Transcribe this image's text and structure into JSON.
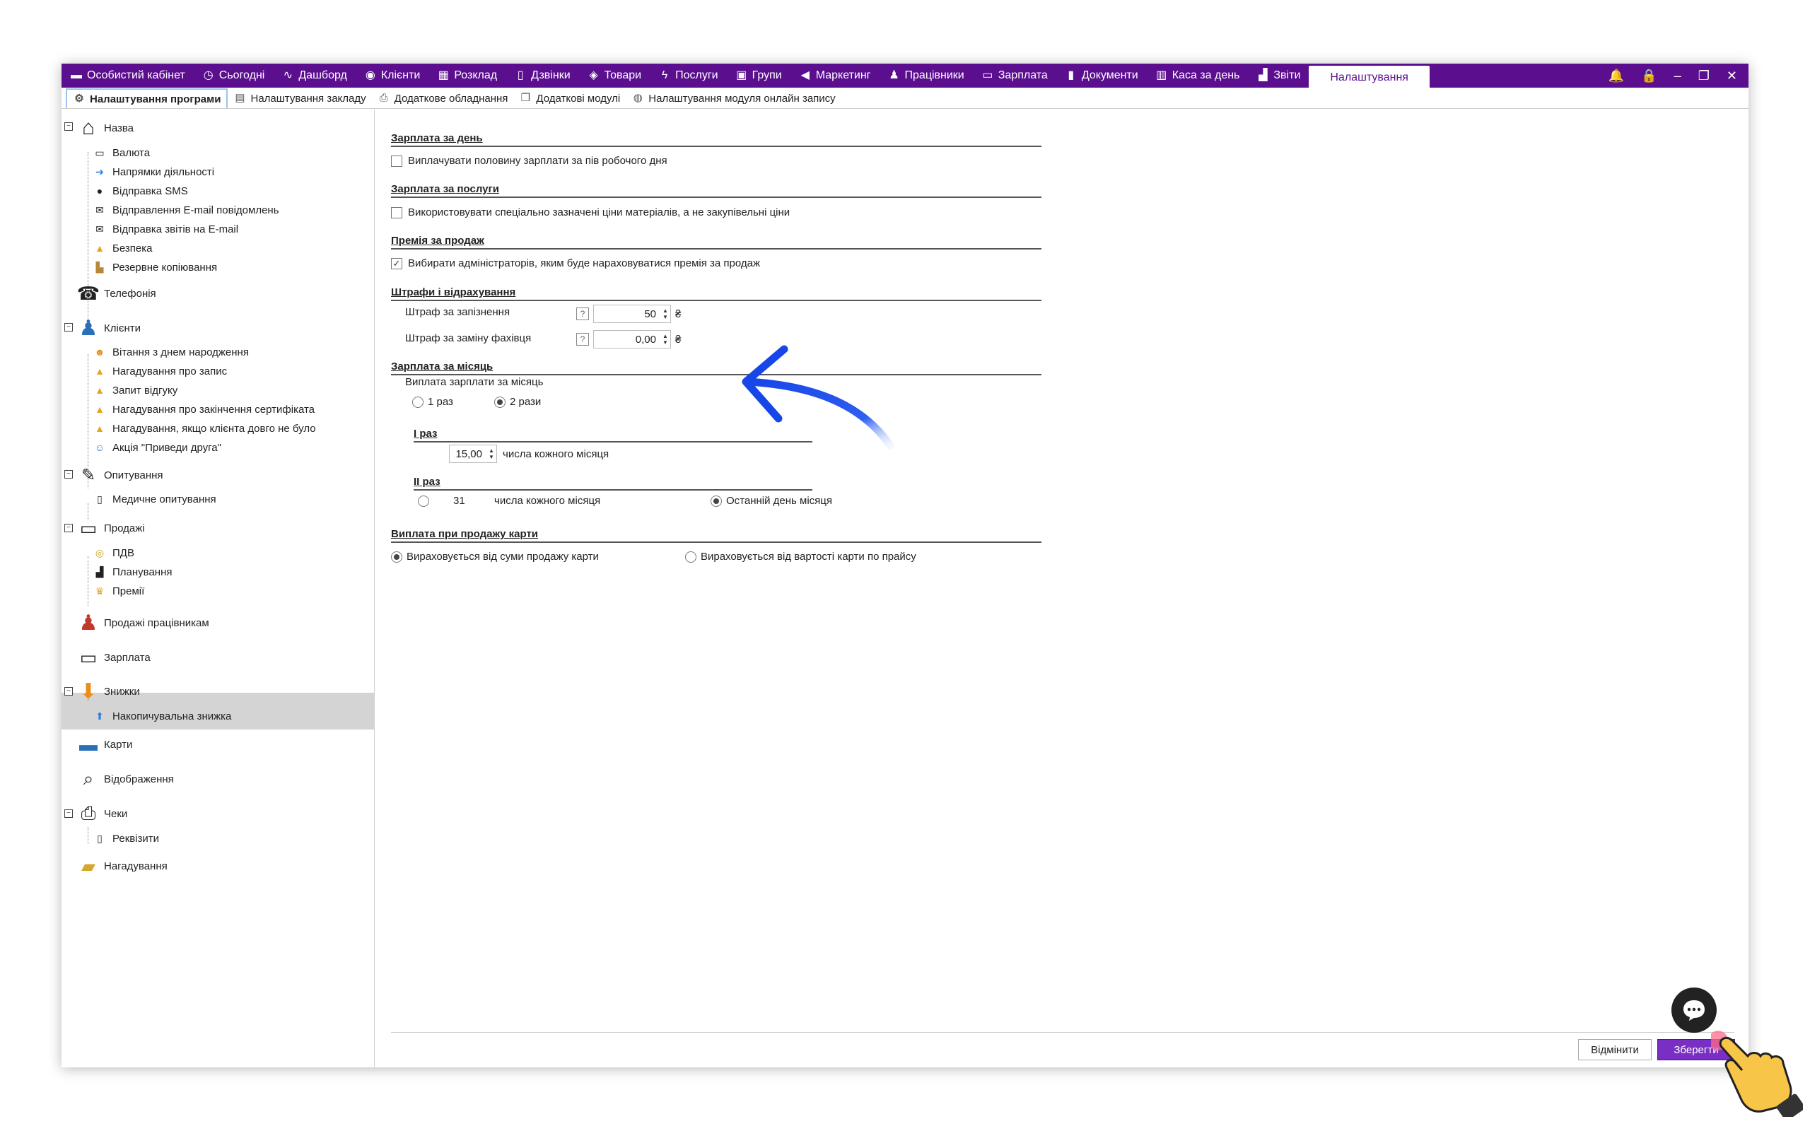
{
  "topnav": {
    "items": [
      {
        "label": "Особистий кабінет",
        "icon": "briefcase-icon"
      },
      {
        "label": "Сьогодні",
        "icon": "clock-icon"
      },
      {
        "label": "Дашборд",
        "icon": "pulse-icon"
      },
      {
        "label": "Клієнти",
        "icon": "user-circle-icon"
      },
      {
        "label": "Розклад",
        "icon": "calendar-icon"
      },
      {
        "label": "Дзвінки",
        "icon": "phone-icon"
      },
      {
        "label": "Товари",
        "icon": "box-icon"
      },
      {
        "label": "Послуги",
        "icon": "lightning-icon"
      },
      {
        "label": "Групи",
        "icon": "group-icon"
      },
      {
        "label": "Маркетинг",
        "icon": "megaphone-icon"
      },
      {
        "label": "Працівники",
        "icon": "person-icon"
      },
      {
        "label": "Зарплата",
        "icon": "money-icon"
      },
      {
        "label": "Документи",
        "icon": "document-icon"
      },
      {
        "label": "Каса за день",
        "icon": "calculator-icon"
      },
      {
        "label": "Звіти",
        "icon": "bar-chart-icon"
      }
    ],
    "active": "Налаштування"
  },
  "subtabs": [
    {
      "label": "Налаштування програми",
      "icon": "gear-icon"
    },
    {
      "label": "Налаштування закладу",
      "icon": "building-icon"
    },
    {
      "label": "Додаткове обладнання",
      "icon": "printer-icon"
    },
    {
      "label": "Додаткові модулі",
      "icon": "module-icon"
    },
    {
      "label": "Налаштування модуля онлайн запису",
      "icon": "globe-icon"
    }
  ],
  "tree": {
    "nazva": "Назва",
    "valiuta": "Валюта",
    "napriamky": "Напрямки діяльності",
    "sms": "Відправка SMS",
    "email": "Відправлення E-mail повідомлень",
    "zvity_email": "Відправка звітів на E-mail",
    "bezpeka": "Безпека",
    "backup": "Резервне копіювання",
    "telefonia": "Телефонія",
    "klienty": "Клієнти",
    "birthday": "Вітання з днем народження",
    "reminder": "Нагадування про запис",
    "feedback": "Запит відгуку",
    "certificate": "Нагадування про закінчення сертифіката",
    "absent": "Нагадування, якщо клієнта довго не було",
    "friend": "Акція \"Приведи друга\"",
    "opytuvannia": "Опитування",
    "medical": "Медичне опитування",
    "prodazhi": "Продажі",
    "pdv": "ПДВ",
    "planning": "Планування",
    "premii": "Премії",
    "prodazhi_prac": "Продажі працівникам",
    "zarplata": "Зарплата",
    "znyzhky": "Знижки",
    "nakopychuvalna": "Накопичувальна знижка",
    "karty": "Карти",
    "vidobrazhennia": "Відображення",
    "cheky": "Чеки",
    "rekvizyty": "Реквізити",
    "nahaduvannia": "Нагадування"
  },
  "content": {
    "sec_day": "Зарплата за день",
    "half_day": "Виплачувати половину зарплати за пів робочого дня",
    "sec_services": "Зарплата за послуги",
    "special_prices": "Використовувати спеціально зазначені ціни матеріалів, а не закупівельні ціни",
    "sec_bonus": "Премія за продаж",
    "choose_admins": "Вибирати адміністраторів, яким буде нараховуватися премія за продаж",
    "sec_fines": "Штрафи і відрахування",
    "fine_late": "Штраф за запізнення",
    "fine_late_val": "50",
    "fine_replace": "Штраф за заміну фахівця",
    "fine_replace_val": "0,00",
    "currency": "₴",
    "help_mark": "?",
    "sec_month": "Зарплата за місяць",
    "monthly_pay": "Виплата зарплати за місяць",
    "once": "1 раз",
    "twice": "2 рази",
    "first": "I раз",
    "first_val": "15,00",
    "day_of_month": "числа кожного місяця",
    "second": "II раз",
    "second_val": "31",
    "last_day": "Останній день місяця",
    "sec_card": "Виплата при продажу карти",
    "from_sale": "Вираховується від суми продажу карти",
    "from_price": "Вираховується від вартості карти по прайсу"
  },
  "footer": {
    "cancel": "Відмінити",
    "save": "Зберегти"
  }
}
